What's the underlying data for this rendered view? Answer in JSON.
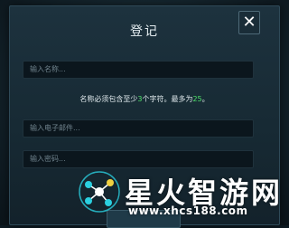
{
  "dialog": {
    "title": "登记",
    "close_symbol": "✕",
    "name_placeholder": "输入名称...",
    "hint_prefix": "名称必须包含至少",
    "hint_min": "3",
    "hint_middle": "个字符。最多为",
    "hint_max": "25",
    "hint_suffix": "。",
    "email_placeholder": "输入电子邮件...",
    "password_placeholder": "输入密码..."
  },
  "watermark": {
    "brand": "星火智游网",
    "url": "www.xhcs188.com"
  },
  "colors": {
    "accent_green": "#4fe06a",
    "panel": "#1d323e",
    "field": "#0b161d"
  }
}
